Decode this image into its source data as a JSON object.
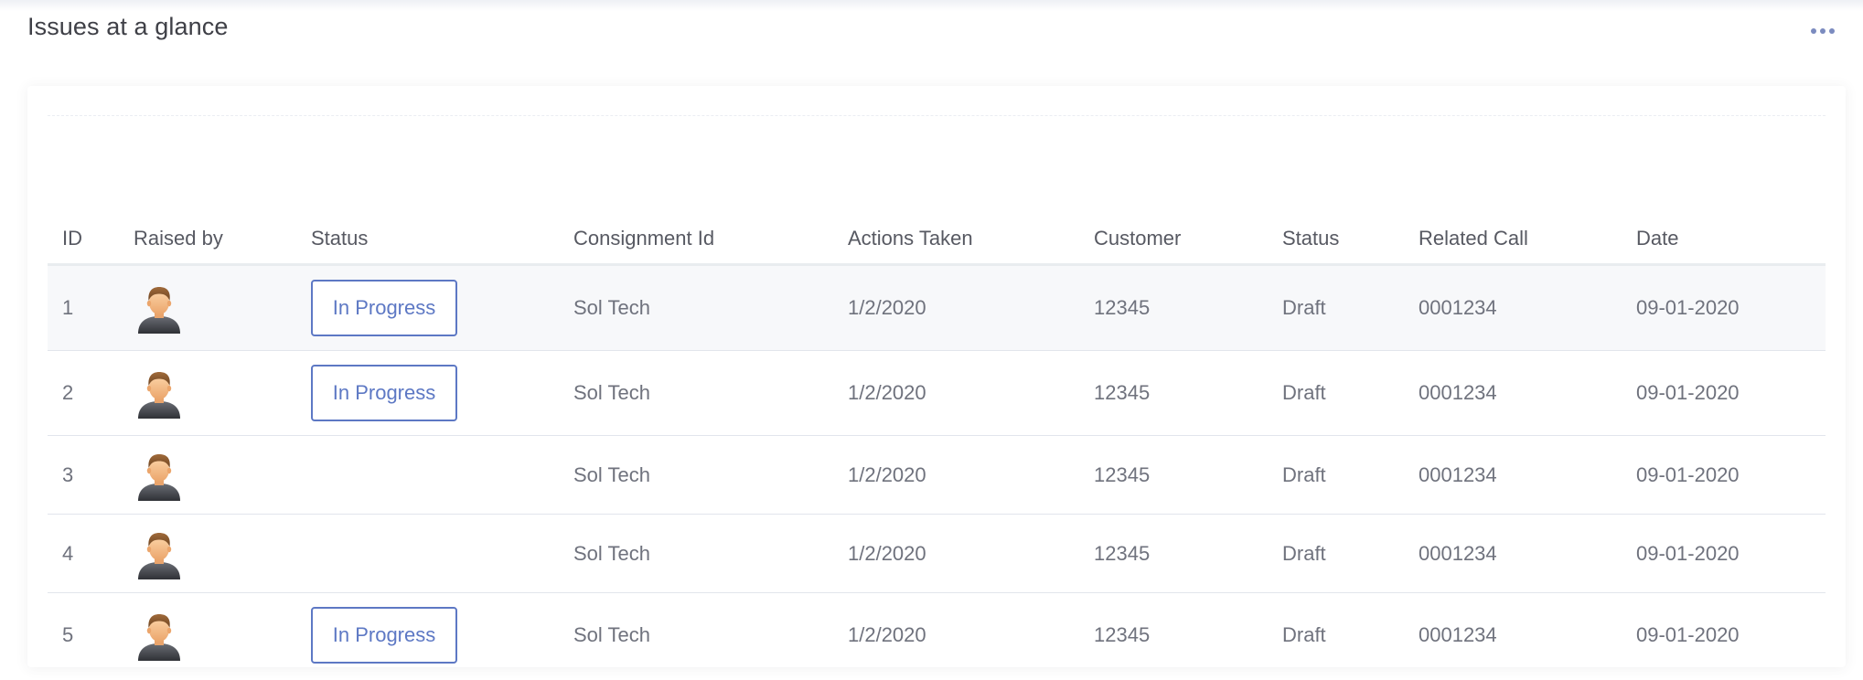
{
  "page": {
    "title": "Issues at a glance",
    "more_menu_icon": "more-horizontal-icon"
  },
  "colors": {
    "accent": "#5d78c4",
    "text": "#575962",
    "muted_text": "#6f727d",
    "row_highlight": "#f7f8fa",
    "divider": "#e2e5ec"
  },
  "table": {
    "columns": [
      "ID",
      "Raised by",
      "Status",
      "Consignment Id",
      "Actions Taken",
      "Customer",
      "Status",
      "Related Call",
      "Date"
    ],
    "rows": [
      {
        "id": "1",
        "raised_by_icon": "user-avatar-icon",
        "status": "In Progress",
        "consignment_id": "Sol Tech",
        "actions_taken": "1/2/2020",
        "customer": "12345",
        "status2": "Draft",
        "related_call": "0001234",
        "date": "09-01-2020"
      },
      {
        "id": "2",
        "raised_by_icon": "user-avatar-icon",
        "status": "In Progress",
        "consignment_id": "Sol Tech",
        "actions_taken": "1/2/2020",
        "customer": "12345",
        "status2": "Draft",
        "related_call": "0001234",
        "date": "09-01-2020"
      },
      {
        "id": "3",
        "raised_by_icon": "user-avatar-icon",
        "status": "",
        "consignment_id": "Sol Tech",
        "actions_taken": "1/2/2020",
        "customer": "12345",
        "status2": "Draft",
        "related_call": "0001234",
        "date": "09-01-2020"
      },
      {
        "id": "4",
        "raised_by_icon": "user-avatar-icon",
        "status": "",
        "consignment_id": "Sol Tech",
        "actions_taken": "1/2/2020",
        "customer": "12345",
        "status2": "Draft",
        "related_call": "0001234",
        "date": "09-01-2020"
      },
      {
        "id": "5",
        "raised_by_icon": "user-avatar-icon",
        "status": "In Progress",
        "consignment_id": "Sol Tech",
        "actions_taken": "1/2/2020",
        "customer": "12345",
        "status2": "Draft",
        "related_call": "0001234",
        "date": "09-01-2020"
      }
    ]
  }
}
